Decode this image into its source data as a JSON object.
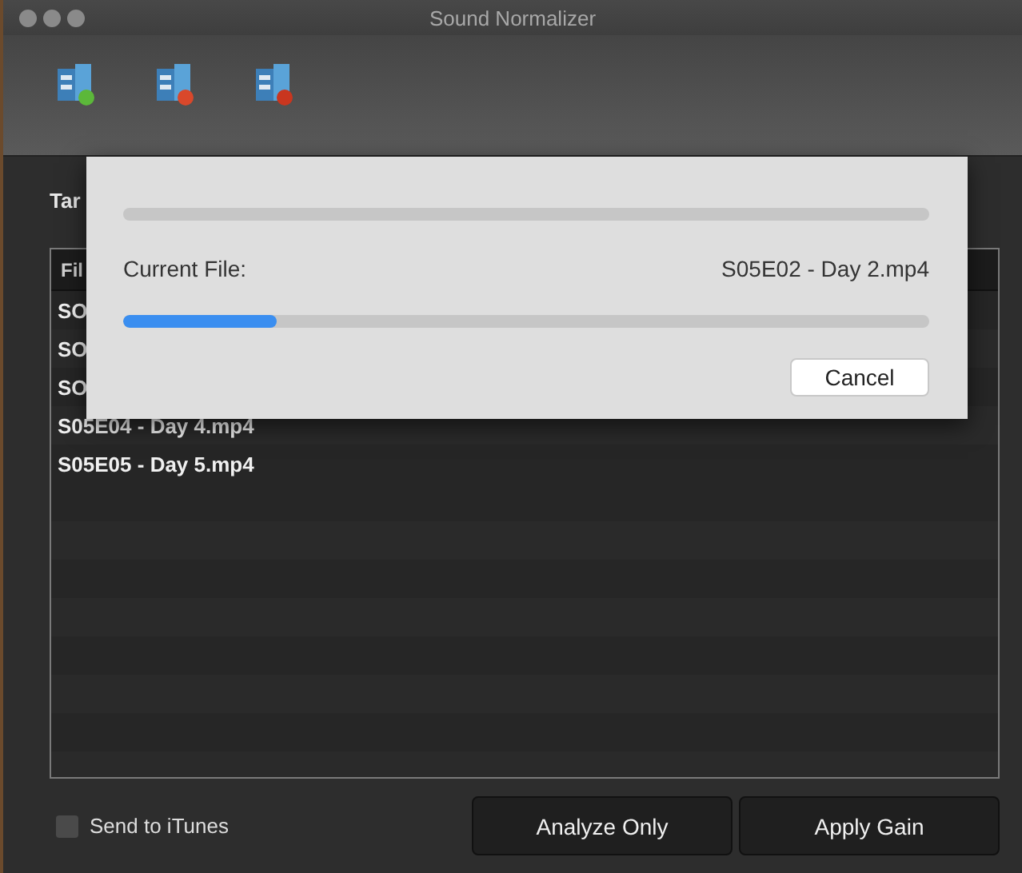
{
  "window": {
    "title": "Sound Normalizer"
  },
  "toolbar": {
    "items": [
      {
        "kind": "add"
      },
      {
        "kind": "remove"
      },
      {
        "kind": "clear"
      }
    ]
  },
  "target_label": "Tar",
  "file_list": {
    "column_1": "Fil",
    "rows": [
      "SO",
      "SO",
      "SO",
      "S05E04 - Day 4.mp4",
      "S05E05 - Day 5.mp4"
    ]
  },
  "progress_sheet": {
    "overall": {
      "level": 0
    },
    "current_file_label": "Current File:",
    "current_file": "S05E02 - Day 2.mp4",
    "file_progress": {
      "level": 0.19
    },
    "cancel": "Cancel"
  },
  "options": {
    "send_to_itunes": {
      "label": "Send to iTunes",
      "checked": false
    }
  },
  "buttons": [
    "Analyze Only",
    "Apply Gain"
  ]
}
